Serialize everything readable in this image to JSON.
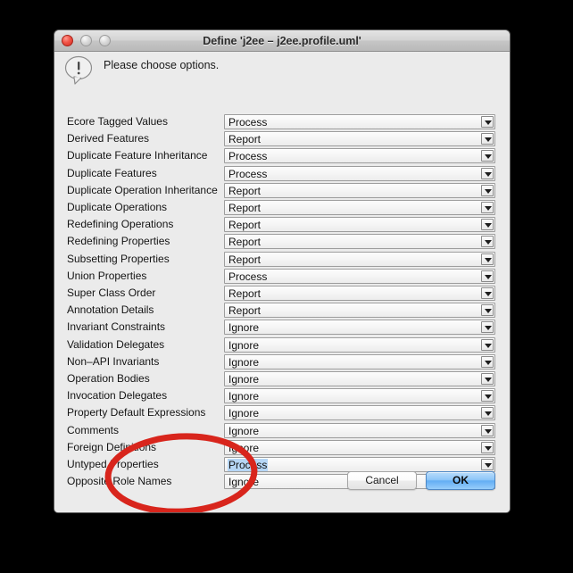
{
  "window": {
    "title": "Define 'j2ee – j2ee.profile.uml'",
    "traffic_lights": {
      "close": "close-button",
      "minimize": "minimize-button",
      "zoom": "zoom-button"
    }
  },
  "header": {
    "icon": "alert-speech-bubble-icon",
    "message": "Please choose options."
  },
  "options": [
    {
      "label": "Ecore Tagged Values",
      "value": "Process",
      "selected": false
    },
    {
      "label": "Derived Features",
      "value": "Report",
      "selected": false
    },
    {
      "label": "Duplicate Feature Inheritance",
      "value": "Process",
      "selected": false
    },
    {
      "label": "Duplicate Features",
      "value": "Process",
      "selected": false
    },
    {
      "label": "Duplicate Operation Inheritance",
      "value": "Report",
      "selected": false
    },
    {
      "label": "Duplicate Operations",
      "value": "Report",
      "selected": false
    },
    {
      "label": "Redefining Operations",
      "value": "Report",
      "selected": false
    },
    {
      "label": "Redefining Properties",
      "value": "Report",
      "selected": false
    },
    {
      "label": "Subsetting Properties",
      "value": "Report",
      "selected": false
    },
    {
      "label": "Union Properties",
      "value": "Process",
      "selected": false
    },
    {
      "label": "Super Class Order",
      "value": "Report",
      "selected": false
    },
    {
      "label": "Annotation Details",
      "value": "Report",
      "selected": false
    },
    {
      "label": "Invariant Constraints",
      "value": "Ignore",
      "selected": false
    },
    {
      "label": "Validation Delegates",
      "value": "Ignore",
      "selected": false
    },
    {
      "label": "Non–API Invariants",
      "value": "Ignore",
      "selected": false
    },
    {
      "label": "Operation Bodies",
      "value": "Ignore",
      "selected": false
    },
    {
      "label": "Invocation Delegates",
      "value": "Ignore",
      "selected": false
    },
    {
      "label": "Property Default Expressions",
      "value": "Ignore",
      "selected": false
    },
    {
      "label": "Comments",
      "value": "Ignore",
      "selected": false
    },
    {
      "label": "Foreign Definitions",
      "value": "Ignore",
      "selected": false
    },
    {
      "label": "Untyped Properties",
      "value": "Process",
      "selected": true
    },
    {
      "label": "Opposite Role Names",
      "value": "Ignore",
      "selected": false
    }
  ],
  "buttons": {
    "cancel_label": "Cancel",
    "ok_label": "OK"
  },
  "annotation": {
    "shape": "ellipse",
    "color": "#d8251c",
    "highlights": [
      "Foreign Definitions",
      "Untyped Properties",
      "Opposite Role Names",
      "Comments"
    ]
  },
  "colors": {
    "desktop_background": "#000000",
    "window_background": "#ebebeb",
    "selection_highlight": "#b6d6f5",
    "default_button": "#8ec6f8",
    "annotation_red": "#d8251c"
  }
}
